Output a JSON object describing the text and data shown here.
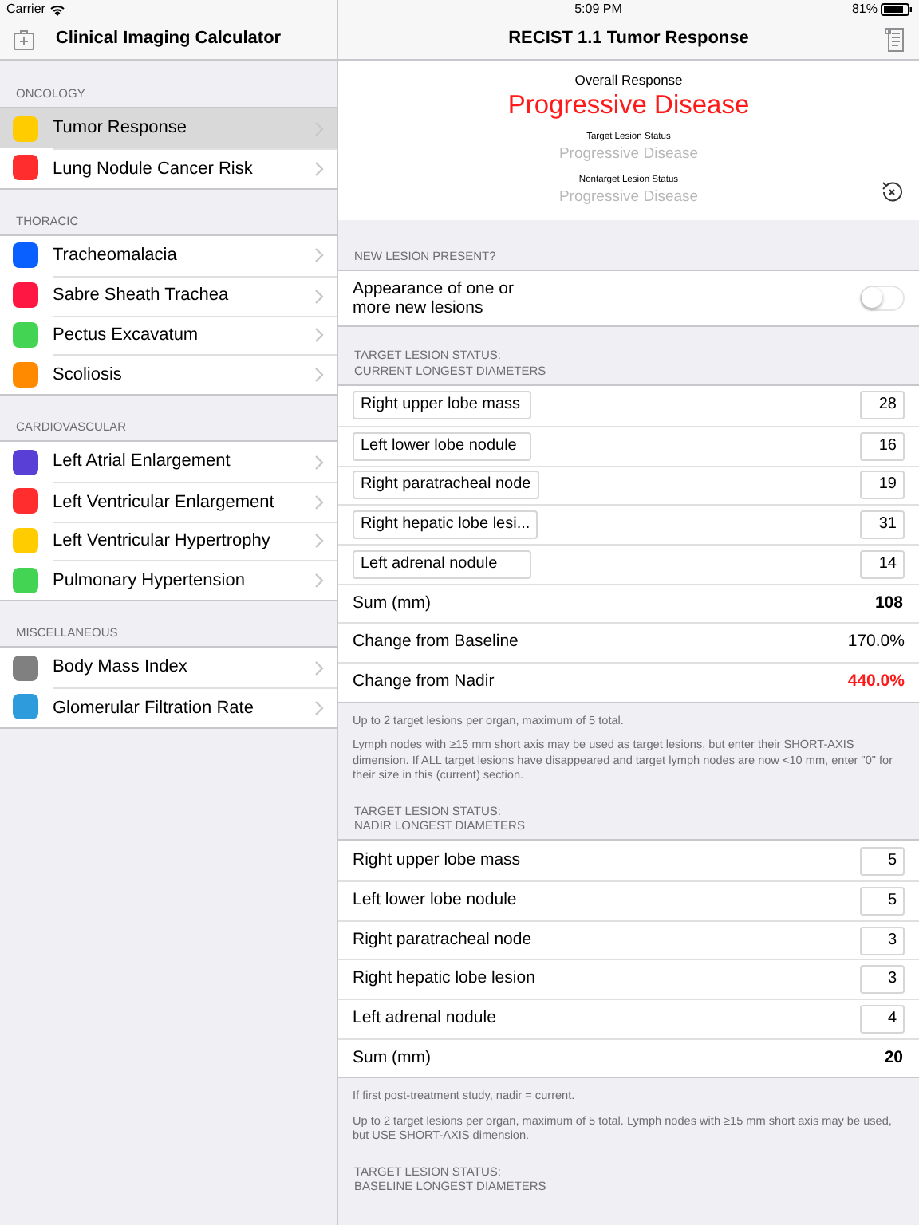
{
  "status_bar": {
    "carrier": "Carrier",
    "time": "5:09 PM",
    "battery": "81%"
  },
  "sidebar": {
    "title": "Clinical Imaging Calculator",
    "sections": [
      {
        "header": "ONCOLOGY",
        "items": [
          {
            "label": "Tumor Response",
            "color": "#ffcc00",
            "selected": true
          },
          {
            "label": "Lung Nodule Cancer Risk",
            "color": "#ff2d2d",
            "selected": false
          }
        ]
      },
      {
        "header": "THORACIC",
        "items": [
          {
            "label": "Tracheomalacia",
            "color": "#0a60ff",
            "selected": false
          },
          {
            "label": "Sabre Sheath Trachea",
            "color": "#ff1744",
            "selected": false
          },
          {
            "label": "Pectus Excavatum",
            "color": "#44d454",
            "selected": false
          },
          {
            "label": "Scoliosis",
            "color": "#ff8a00",
            "selected": false
          }
        ]
      },
      {
        "header": "CARDIOVASCULAR",
        "items": [
          {
            "label": "Left Atrial Enlargement",
            "color": "#5a3fd6",
            "selected": false
          },
          {
            "label": "Left Ventricular Enlargement",
            "color": "#ff2d2d",
            "selected": false
          },
          {
            "label": "Left Ventricular Hypertrophy",
            "color": "#ffcc00",
            "selected": false
          },
          {
            "label": "Pulmonary Hypertension",
            "color": "#44d454",
            "selected": false
          }
        ]
      },
      {
        "header": "MISCELLANEOUS",
        "items": [
          {
            "label": "Body Mass Index",
            "color": "#808080",
            "selected": false
          },
          {
            "label": "Glomerular Filtration Rate",
            "color": "#2e9bdc",
            "selected": false
          }
        ]
      }
    ]
  },
  "detail": {
    "title": "RECIST 1.1 Tumor Response",
    "result": {
      "overall_label": "Overall Response",
      "overall": "Progressive Disease",
      "target_label": "Target Lesion Status",
      "target": "Progressive Disease",
      "nontarget_label": "Nontarget Lesion Status",
      "nontarget": "Progressive Disease"
    },
    "sections": [
      {
        "header": [
          "NEW LESION PRESENT?"
        ],
        "rows": [
          {
            "kind": "toggle",
            "label": "Appearance of one or more new lesions",
            "on": false
          }
        ]
      },
      {
        "header": [
          "TARGET LESION STATUS:",
          "CURRENT LONGEST DIAMETERS"
        ],
        "rows": [
          {
            "kind": "named-entry",
            "label": "Right upper lobe mass",
            "value": "28"
          },
          {
            "kind": "named-entry",
            "label": "Left lower lobe nodule",
            "value": "16"
          },
          {
            "kind": "named-entry",
            "label": "Right paratracheal node",
            "value": "19"
          },
          {
            "kind": "named-entry",
            "label": "Right hepatic lobe lesi...",
            "value": "31"
          },
          {
            "kind": "named-entry",
            "label": "Left adrenal nodule",
            "value": "14"
          },
          {
            "kind": "total",
            "label": "Sum (mm)",
            "value": "108"
          },
          {
            "kind": "stat",
            "label": "Change from Baseline",
            "value": "170.0%",
            "alert": false
          },
          {
            "kind": "stat",
            "label": "Change from Nadir",
            "value": "440.0%",
            "alert": true
          }
        ],
        "footer": [
          "Up to 2 target lesions per organ, maximum of 5 total.",
          "Lymph nodes with ≥15 mm short axis may be used as target lesions, but enter their SHORT-AXIS dimension. If ALL target lesions have disappeared and target lymph nodes are now <10 mm, enter \"0\" for their size in this (current) section."
        ]
      },
      {
        "header": [
          "TARGET LESION STATUS:",
          "NADIR LONGEST DIAMETERS"
        ],
        "rows": [
          {
            "kind": "entry",
            "label": "Right upper lobe mass",
            "value": "5"
          },
          {
            "kind": "entry",
            "label": "Left lower lobe nodule",
            "value": "5"
          },
          {
            "kind": "entry",
            "label": "Right paratracheal node",
            "value": "3"
          },
          {
            "kind": "entry",
            "label": "Right hepatic lobe lesion",
            "value": "3"
          },
          {
            "kind": "entry",
            "label": "Left adrenal nodule",
            "value": "4"
          },
          {
            "kind": "total",
            "label": "Sum (mm)",
            "value": "20"
          }
        ],
        "footer": [
          "If first post-treatment study, nadir = current.",
          "Up to 2 target lesions per organ, maximum of 5 total. Lymph nodes with ≥15 mm short axis may be used, but USE SHORT-AXIS dimension."
        ]
      },
      {
        "header": [
          "TARGET LESION STATUS:",
          "BASELINE LONGEST DIAMETERS"
        ]
      }
    ]
  }
}
